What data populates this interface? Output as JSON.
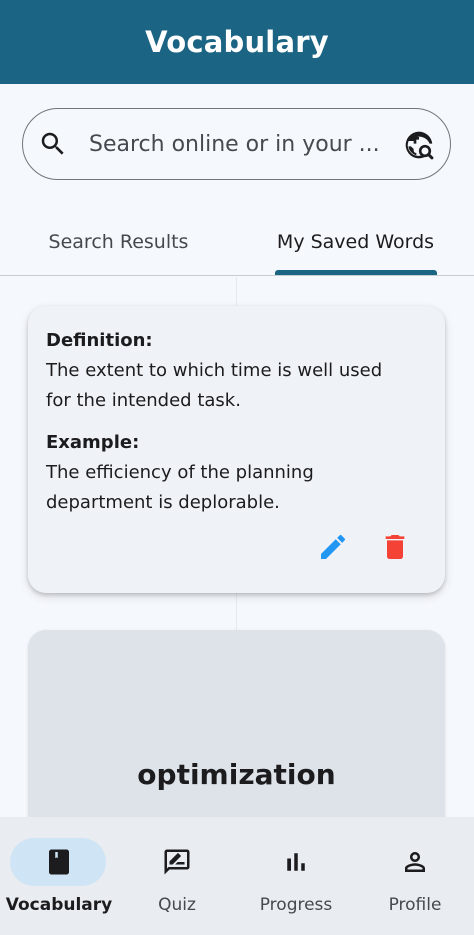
{
  "app_bar": {
    "title": "Vocabulary",
    "color": "#1b6483"
  },
  "search": {
    "placeholder": "Search online or in your ...",
    "value": "",
    "leading_icon": "search-icon",
    "trailing_icon": "travel-explore-icon"
  },
  "tabs": [
    {
      "label": "Search Results",
      "selected": false
    },
    {
      "label": "My Saved Words",
      "selected": true
    }
  ],
  "cards": [
    {
      "definition_label": "Definition:",
      "definition": "The extent to which time is well used for the intended task.",
      "example_label": "Example:",
      "example": "The efficiency of the planning department is deplorable.",
      "actions": [
        {
          "icon": "edit-icon",
          "color": "#2196f3"
        },
        {
          "icon": "delete-icon",
          "color": "#f44336"
        }
      ]
    },
    {
      "word": "optimization"
    }
  ],
  "bottom_nav": [
    {
      "label": "Vocabulary",
      "icon": "book-icon",
      "active": true
    },
    {
      "label": "Quiz",
      "icon": "quiz-icon",
      "active": false
    },
    {
      "label": "Progress",
      "icon": "bar-chart-icon",
      "active": false
    },
    {
      "label": "Profile",
      "icon": "person-icon",
      "active": false
    }
  ]
}
